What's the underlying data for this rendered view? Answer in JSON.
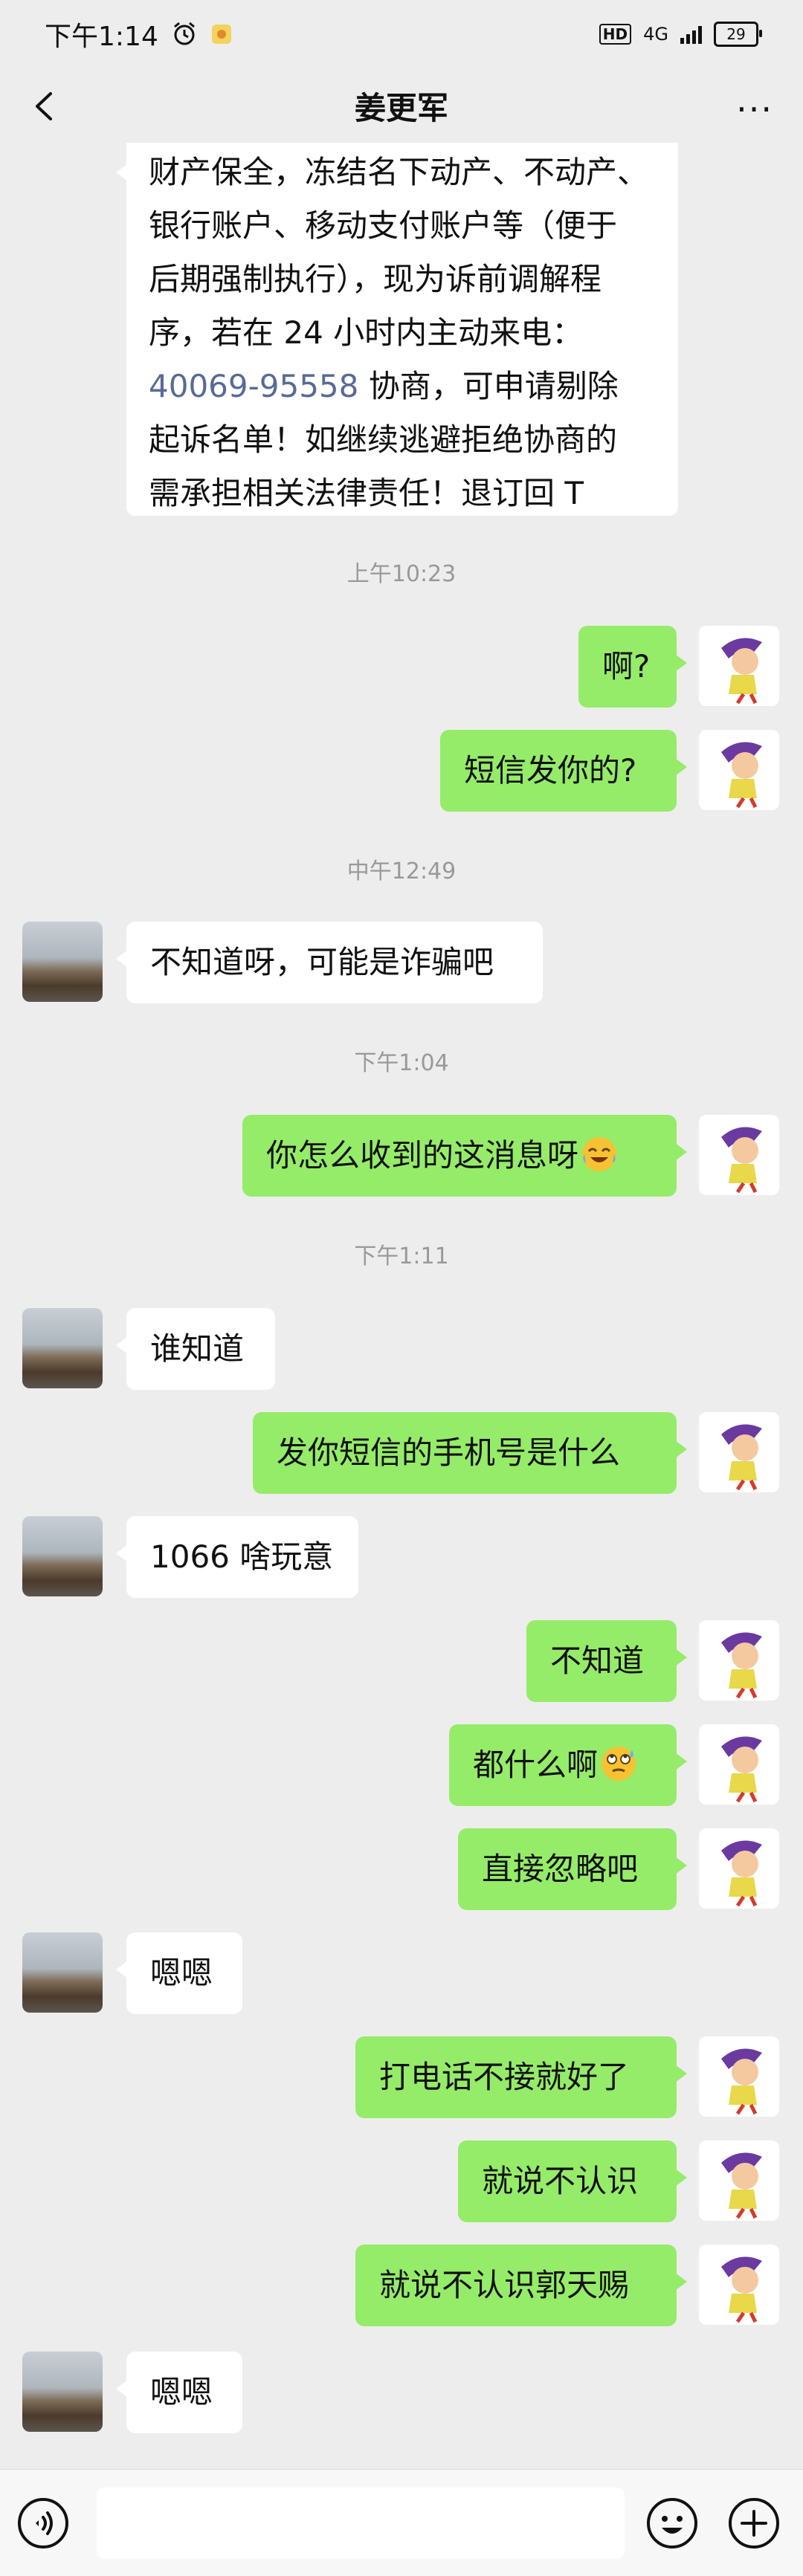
{
  "status_bar": {
    "time": "下午1:14",
    "hd": "HD",
    "network": "4G",
    "battery": "29"
  },
  "header": {
    "title": "姜更军",
    "more": "···"
  },
  "messages": {
    "m0": {
      "line1": "财产保全，冻结名下动产、不动产、",
      "line2": "银行账户、移动支付账户等（便于",
      "line3": "后期强制执行），现为诉前调解程",
      "line4": "序，若在 24 小时内主动来电：",
      "link": "40069-95558",
      "line5_rest": " 协商，可申请剔除",
      "line6": "起诉名单！如继续逃避拒绝协商的",
      "line7": "需承担相关法律责任！退订回 T"
    },
    "t1": "上午10:23",
    "m1": "啊?",
    "m2": "短信发你的?",
    "t2": "中午12:49",
    "m3": "不知道呀，可能是诈骗吧",
    "t3": "下午1:04",
    "m4": "你怎么收到的这消息呀",
    "t4": "下午1:11",
    "m5": "谁知道",
    "m6": "发你短信的手机号是什么",
    "m7": "1066 啥玩意",
    "m8": "不知道",
    "m9": "都什么啊",
    "m10": "直接忽略吧",
    "m11": "嗯嗯",
    "m12": "打电话不接就好了",
    "m13": "就说不认识",
    "m14": "就说不认识郭天赐",
    "m15": "嗯嗯"
  },
  "icons": {
    "m4_emoji": "laughing-crying-emoji",
    "m9_emoji": "eye-roll-sweat-emoji"
  },
  "colors": {
    "outgoing_bubble": "#95ec69",
    "incoming_bubble": "#ffffff",
    "background": "#ededed",
    "link": "#576b95"
  }
}
